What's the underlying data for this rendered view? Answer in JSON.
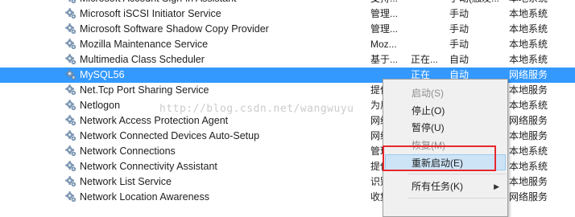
{
  "services": [
    {
      "name": "Microsoft Account Sign-in Assistant",
      "description": "支持...",
      "status": "",
      "startup": "手动(触发...",
      "logon": "本地系统"
    },
    {
      "name": "Microsoft iSCSI Initiator Service",
      "description": "管理...",
      "status": "",
      "startup": "手动",
      "logon": "本地系统"
    },
    {
      "name": "Microsoft Software Shadow Copy Provider",
      "description": "管理...",
      "status": "",
      "startup": "手动",
      "logon": "本地系统"
    },
    {
      "name": "Mozilla Maintenance Service",
      "description": "Moz...",
      "status": "",
      "startup": "手动",
      "logon": "本地系统"
    },
    {
      "name": "Multimedia Class Scheduler",
      "description": "基于...",
      "status": "正在...",
      "startup": "自动",
      "logon": "本地系统"
    },
    {
      "name": "MySQL56",
      "description": "",
      "status": "正在",
      "startup": "自动",
      "logon": "网络服务"
    },
    {
      "name": "Net.Tcp Port Sharing Service",
      "description": "提供",
      "status": "",
      "startup": "",
      "logon": "本地服务"
    },
    {
      "name": "Netlogon",
      "description": "为用",
      "status": "",
      "startup": "",
      "logon": "本地系统"
    },
    {
      "name": "Network Access Protection Agent",
      "description": "网络",
      "status": "",
      "startup": "",
      "logon": "网络服务"
    },
    {
      "name": "Network Connected Devices Auto-Setup",
      "description": "网络",
      "status": "",
      "startup": "",
      "logon": "本地服务"
    },
    {
      "name": "Network Connections",
      "description": "管理",
      "status": "",
      "startup": "",
      "logon": "本地系统"
    },
    {
      "name": "Network Connectivity Assistant",
      "description": "提供",
      "status": "",
      "startup": "",
      "logon": "本地系统"
    },
    {
      "name": "Network List Service",
      "description": "识别",
      "status": "",
      "startup": "",
      "logon": "本地服务"
    },
    {
      "name": "Network Location Awareness",
      "description": "收集",
      "status": "",
      "startup": "",
      "logon": "网络服务"
    }
  ],
  "selected_service": "MySQL56",
  "context_menu": {
    "start": "启动(S)",
    "stop": "停止(O)",
    "pause": "暂停(U)",
    "resume": "恢复(M)",
    "restart": "重新启动(E)",
    "all_tasks": "所有任务(K)"
  },
  "watermark": "http://blog.csdn.net/wangwuyu",
  "colors": {
    "selection": "#3399ff",
    "menu_hover": "#cde4f7",
    "annotation_box": "#e8282d"
  }
}
